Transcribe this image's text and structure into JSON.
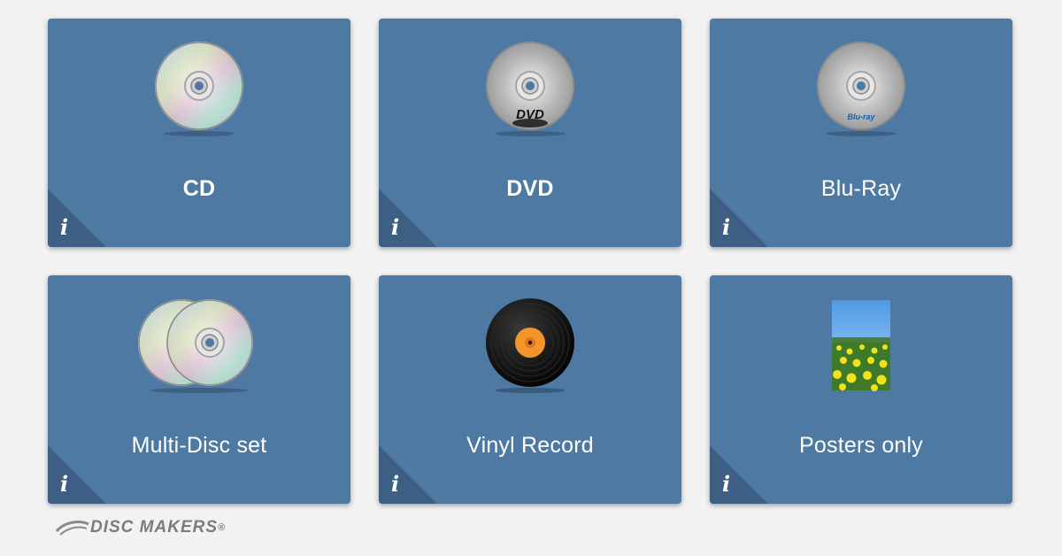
{
  "cards": [
    {
      "label": "CD",
      "icon": "cd-disc-icon",
      "info": "i"
    },
    {
      "label": "DVD",
      "icon": "dvd-disc-icon",
      "info": "i",
      "disc_text": "DVD"
    },
    {
      "label": "Blu-Ray",
      "icon": "bluray-disc-icon",
      "info": "i",
      "disc_text": "Blu-ray"
    },
    {
      "label": "Multi-Disc set",
      "icon": "multi-disc-icon",
      "info": "i"
    },
    {
      "label": "Vinyl Record",
      "icon": "vinyl-record-icon",
      "info": "i"
    },
    {
      "label": "Posters only",
      "icon": "poster-image-icon",
      "info": "i"
    }
  ],
  "brand": {
    "name": "DISC MAKERS",
    "mark": "®"
  },
  "colors": {
    "card": "#4e79a3",
    "corner": "#3c5f83",
    "background": "#f2f2f2",
    "vinyl_label": "#f3962a"
  }
}
